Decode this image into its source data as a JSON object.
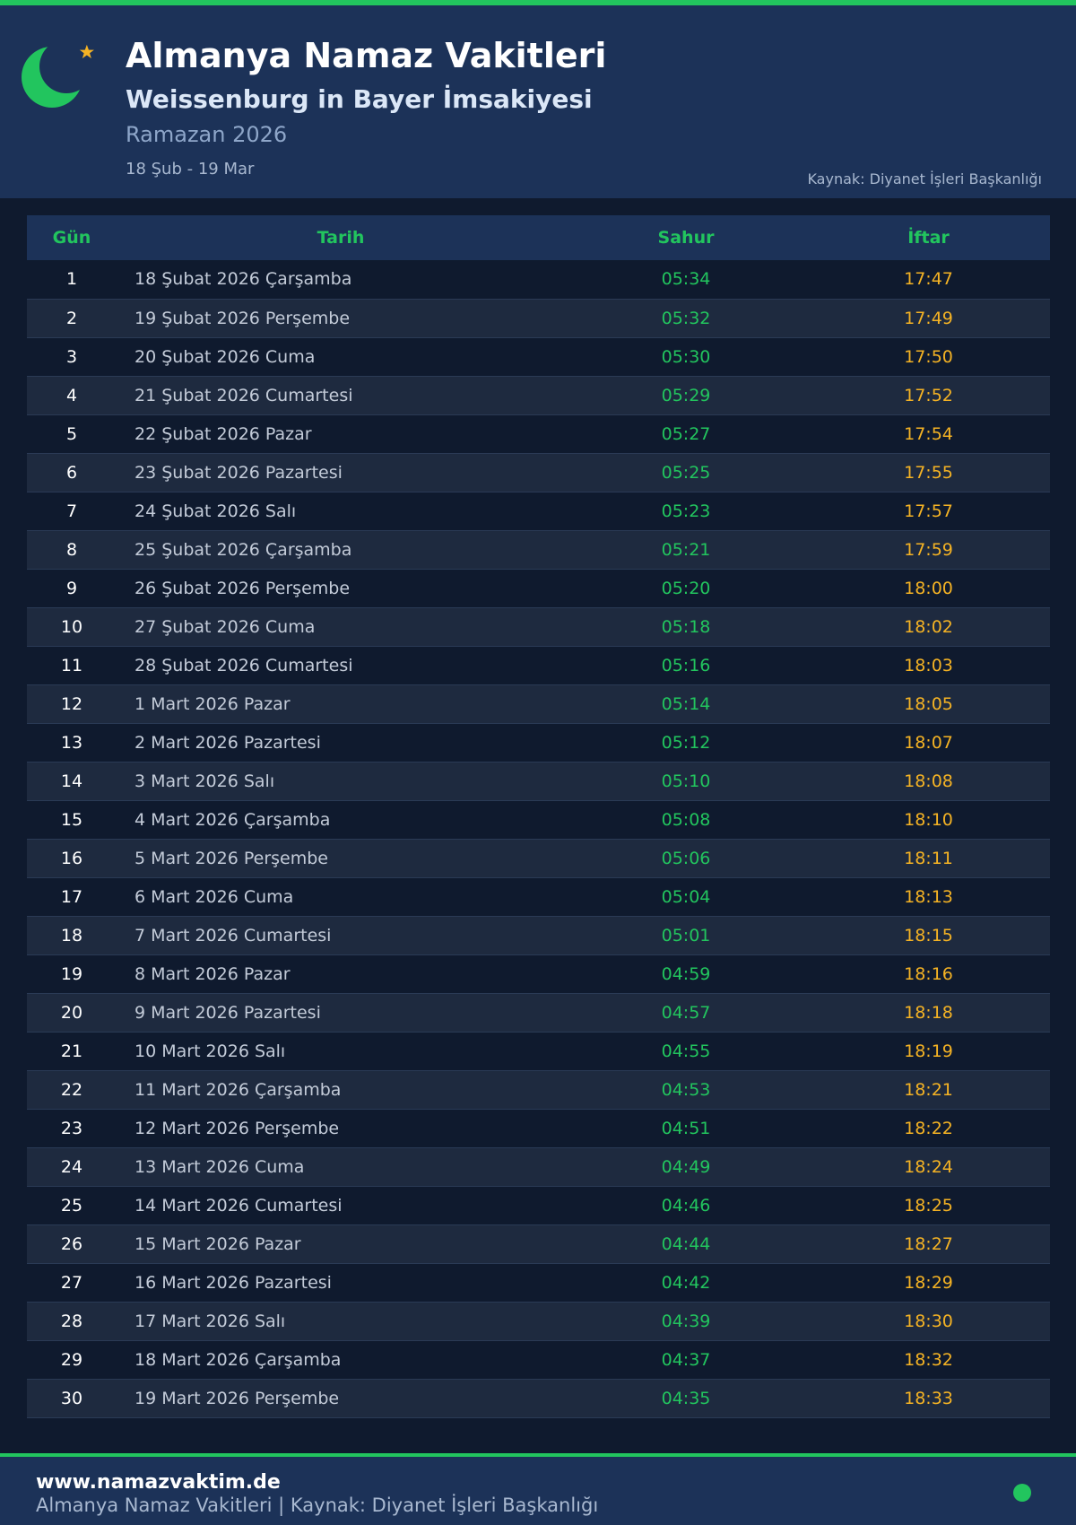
{
  "header": {
    "title": "Almanya Namaz Vakitleri",
    "subtitle": "Weissenburg in Bayer İmsakiyesi",
    "period": "Ramazan 2026",
    "range": "18 Şub - 19 Mar",
    "source": "Kaynak: Diyanet İşleri Başkanlığı",
    "logo_icon": "crescent-star-icon"
  },
  "table": {
    "headers": {
      "gun": "Gün",
      "tarih": "Tarih",
      "sahur": "Sahur",
      "iftar": "İftar"
    },
    "rows": [
      [
        "1",
        "18 Şubat 2026 Çarşamba",
        "05:34",
        "17:47"
      ],
      [
        "2",
        "19 Şubat 2026 Perşembe",
        "05:32",
        "17:49"
      ],
      [
        "3",
        "20 Şubat 2026 Cuma",
        "05:30",
        "17:50"
      ],
      [
        "4",
        "21 Şubat 2026 Cumartesi",
        "05:29",
        "17:52"
      ],
      [
        "5",
        "22 Şubat 2026 Pazar",
        "05:27",
        "17:54"
      ],
      [
        "6",
        "23 Şubat 2026 Pazartesi",
        "05:25",
        "17:55"
      ],
      [
        "7",
        "24 Şubat 2026 Salı",
        "05:23",
        "17:57"
      ],
      [
        "8",
        "25 Şubat 2026 Çarşamba",
        "05:21",
        "17:59"
      ],
      [
        "9",
        "26 Şubat 2026 Perşembe",
        "05:20",
        "18:00"
      ],
      [
        "10",
        "27 Şubat 2026 Cuma",
        "05:18",
        "18:02"
      ],
      [
        "11",
        "28 Şubat 2026 Cumartesi",
        "05:16",
        "18:03"
      ],
      [
        "12",
        "1 Mart 2026 Pazar",
        "05:14",
        "18:05"
      ],
      [
        "13",
        "2 Mart 2026 Pazartesi",
        "05:12",
        "18:07"
      ],
      [
        "14",
        "3 Mart 2026 Salı",
        "05:10",
        "18:08"
      ],
      [
        "15",
        "4 Mart 2026 Çarşamba",
        "05:08",
        "18:10"
      ],
      [
        "16",
        "5 Mart 2026 Perşembe",
        "05:06",
        "18:11"
      ],
      [
        "17",
        "6 Mart 2026 Cuma",
        "05:04",
        "18:13"
      ],
      [
        "18",
        "7 Mart 2026 Cumartesi",
        "05:01",
        "18:15"
      ],
      [
        "19",
        "8 Mart 2026 Pazar",
        "04:59",
        "18:16"
      ],
      [
        "20",
        "9 Mart 2026 Pazartesi",
        "04:57",
        "18:18"
      ],
      [
        "21",
        "10 Mart 2026 Salı",
        "04:55",
        "18:19"
      ],
      [
        "22",
        "11 Mart 2026 Çarşamba",
        "04:53",
        "18:21"
      ],
      [
        "23",
        "12 Mart 2026 Perşembe",
        "04:51",
        "18:22"
      ],
      [
        "24",
        "13 Mart 2026 Cuma",
        "04:49",
        "18:24"
      ],
      [
        "25",
        "14 Mart 2026 Cumartesi",
        "04:46",
        "18:25"
      ],
      [
        "26",
        "15 Mart 2026 Pazar",
        "04:44",
        "18:27"
      ],
      [
        "27",
        "16 Mart 2026 Pazartesi",
        "04:42",
        "18:29"
      ],
      [
        "28",
        "17 Mart 2026 Salı",
        "04:39",
        "18:30"
      ],
      [
        "29",
        "18 Mart 2026 Çarşamba",
        "04:37",
        "18:32"
      ],
      [
        "30",
        "19 Mart 2026 Perşembe",
        "04:35",
        "18:33"
      ]
    ]
  },
  "footer": {
    "site": "www.namazvaktim.de",
    "text": "Almanya Namaz Vakitleri | Kaynak: Diyanet İşleri Başkanlığı"
  },
  "colors": {
    "accent": "#22c55e",
    "iftar": "#f5b324",
    "header_bg": "#1c3258",
    "page_bg": "#0f1a2e"
  }
}
